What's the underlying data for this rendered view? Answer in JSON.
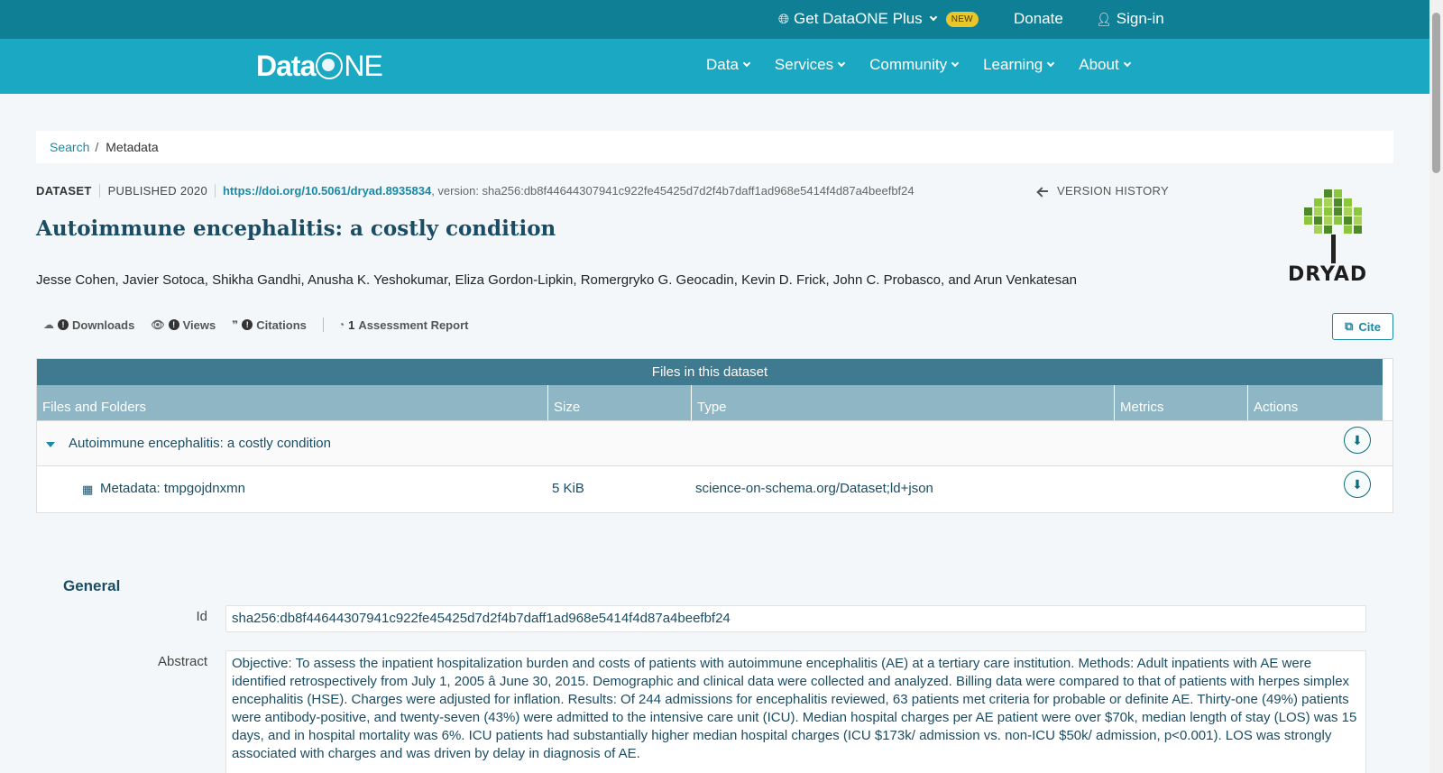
{
  "topbar": {
    "plus_label": "Get DataONE Plus",
    "new_badge": "NEW",
    "donate": "Donate",
    "signin": "Sign-in"
  },
  "nav": {
    "logo_left": "Data",
    "logo_right": "NE",
    "items": [
      "Data",
      "Services",
      "Community",
      "Learning",
      "About"
    ]
  },
  "breadcrumb": {
    "search": "Search",
    "separator": "/",
    "current": "Metadata"
  },
  "dataset": {
    "kind": "DATASET",
    "published": "PUBLISHED 2020",
    "doi": "https://doi.org/10.5061/dryad.8935834",
    "version": ", version: sha256:db8f44644307941c922fe45425d7d2f4b7daff1ad968e5414f4d87a4beefbf24",
    "version_history": "VERSION HISTORY",
    "title": "Autoimmune encephalitis: a costly condition",
    "authors": "Jesse Cohen, Javier Sotoca, Shikha Gandhi, Anusha K. Yeshokumar, Eliza Gordon-Lipkin, Romergryko G. Geocadin, Kevin D. Frick, John C. Probasco, and Arun Venkatesan",
    "repo_logo_text": "DRYAD"
  },
  "metrics": {
    "downloads": "Downloads",
    "views": "Views",
    "citations": "Citations",
    "assessment_count": "1",
    "assessment": "Assessment Report",
    "cite": "Cite"
  },
  "files": {
    "caption": "Files in this dataset",
    "headers": [
      "Files and Folders",
      "Size",
      "Type",
      "Metrics",
      "Actions"
    ],
    "folder": "Autoimmune encephalitis: a costly condition",
    "file": {
      "name": "Metadata: tmpgojdnxmn",
      "size": "5 KiB",
      "type": "science-on-schema.org/Dataset;ld+json"
    }
  },
  "general": {
    "heading": "General",
    "id_label": "Id",
    "id_value": "sha256:db8f44644307941c922fe45425d7d2f4b7daff1ad968e5414f4d87a4beefbf24",
    "abstract_label": "Abstract",
    "abstract_value": "Objective: To assess the inpatient hospitalization burden and costs of patients with autoimmune encephalitis (AE) at a tertiary care institution. Methods: Adult inpatients with AE were identified retrospectively from July 1, 2005 â June 30, 2015. Demographic and clinical data were collected and analyzed. Billing data were compared to that of patients with herpes simplex encephalitis (HSE). Charges were adjusted for inflation. Results: Of 244 admissions for encephalitis reviewed, 63 patients met criteria for probable or definite AE. Thirty-one (49%) patients were antibody-positive, and twenty-seven (43%) were admitted to the intensive care unit (ICU). Median hospital charges per AE patient were over $70k, median length of stay (LOS) was 15 days, and in hospital mortality was 6%. ICU patients had substantially higher median hospital charges (ICU $173k/ admission vs. non-ICU $50k/ admission, p<0.001). LOS was strongly associated with charges and was driven by delay in diagnosis of AE."
  },
  "colors": {
    "topbar": "#0e7f95",
    "nav": "#1ba8c2",
    "accent": "#1a8aa6",
    "table_caption": "#3f7a91",
    "table_header": "#8fb6c4"
  }
}
